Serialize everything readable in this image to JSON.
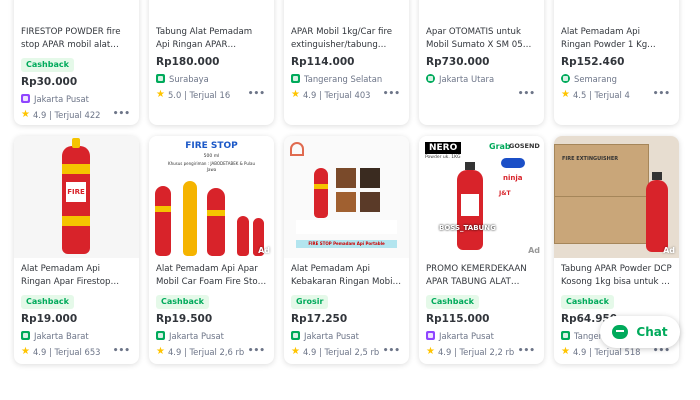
{
  "row1": [
    {
      "title": "FIRESTOP POWDER fire stop APAR mobil alat pemadam",
      "badge": "Cashback",
      "price": "Rp30.000",
      "location": "Jakarta Pusat",
      "shop_type": "purple",
      "rating": "4.9",
      "sold": "Terjual 422"
    },
    {
      "title": "Tabung Alat Pemadam Api Ringan APAR Kebakaran Mo",
      "badge": "",
      "price": "Rp180.000",
      "location": "Surabaya",
      "shop_type": "green",
      "rating": "5.0",
      "sold": "Terjual 16"
    },
    {
      "title": "APAR Mobil 1kg/Car fire extinguisher/tabung pemada",
      "badge": "",
      "price": "Rp114.000",
      "location": "Tangerang Selatan",
      "shop_type": "green",
      "rating": "4.9",
      "sold": "Terjual 403"
    },
    {
      "title": "Apar OTOMATIS untuk Mobil Sumato X SM 05 apar mo",
      "badge": "",
      "price": "Rp730.000",
      "location": "Jakarta Utara",
      "shop_type": "os",
      "rating": "",
      "sold": ""
    },
    {
      "title": "Alat Pemadam Api Ringan Powder 1 Kg Tabung APAR",
      "badge": "",
      "price": "Rp152.460",
      "location": "Semarang",
      "shop_type": "os",
      "rating": "4.5",
      "sold": "Terjual 4"
    }
  ],
  "row2": [
    {
      "title": "Alat Pemadam Api Ringan Apar Firestop Mobil Car",
      "badge": "Cashback",
      "price": "Rp19.000",
      "location": "Jakarta Barat",
      "shop_type": "green",
      "rating": "4.9",
      "sold": "Terjual 653",
      "image_text": "FIRE",
      "ad": ""
    },
    {
      "title": "Alat Pemadam Api Apar Mobil Car Foam Fire Stop Fire",
      "badge": "Cashback",
      "price": "Rp19.500",
      "location": "Jakarta Pusat",
      "shop_type": "green",
      "rating": "4.9",
      "sold": "Terjual 2,6 rb",
      "image_text": "FIRE STOP",
      "image_sub": "500 ml",
      "image_sub2": "Khusus pengiriman : JABODETABEK & Pulau Jawa",
      "ad": "Ad"
    },
    {
      "title": "Alat Pemadam Api Kebakaran Ringan Mobil Fire Stop Fi",
      "badge": "Grosir",
      "price": "Rp17.250",
      "location": "Jakarta Pusat",
      "shop_type": "green",
      "rating": "4.9",
      "sold": "Terjual 2,5 rb",
      "image_text": "FIRE STOP Pemadam Api Portable",
      "ad": ""
    },
    {
      "title": "PROMO KEMERDEKAAN APAR TABUNG ALAT PEMADA",
      "badge": "Cashback",
      "price": "Rp115.000",
      "location": "Jakarta Pusat",
      "shop_type": "purple",
      "rating": "4.9",
      "sold": "Terjual 2,2 rb",
      "image_text": "NERO",
      "image_sub": "Powder uk. 1KG",
      "image_sub2": "BOSS_TABUNG",
      "ad": "Ad"
    },
    {
      "title": "Tabung APAR Powder DCP Kosong 1kg bisa untuk di m",
      "badge": "Cashback",
      "price": "Rp64.950",
      "location": "Tangerang",
      "shop_type": "green",
      "rating": "4.9",
      "sold": "Terjual 518",
      "image_text": "FIRE EXTINGUISHER",
      "ad": "Ad"
    }
  ],
  "chat": {
    "label": "Chat"
  },
  "colors": {
    "accent": "#00aa5b",
    "price": "#31353b",
    "star": "#ffc400",
    "red": "#d8232a"
  }
}
